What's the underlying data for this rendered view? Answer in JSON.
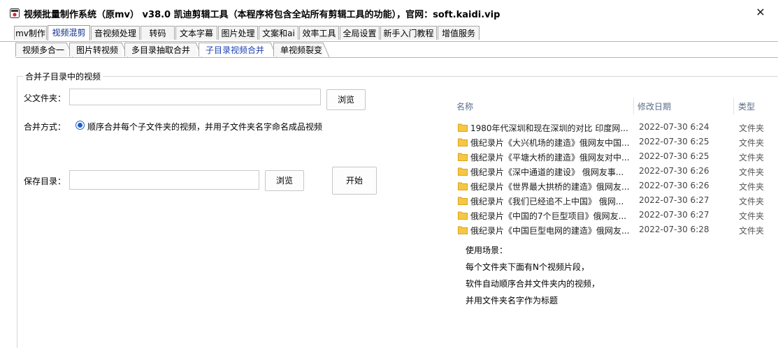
{
  "window": {
    "title": "视频批量制作系统（原mv） v38.0    凯迪剪辑工具（本程序将包含全站所有剪辑工具的功能），官网：soft.kaidi.vip",
    "close_glyph": "✕"
  },
  "main_tabs": [
    {
      "label": "mv制作"
    },
    {
      "label": "视频混剪",
      "active": true
    },
    {
      "label": "音视频处理"
    },
    {
      "label": "转码"
    },
    {
      "label": "文本字幕"
    },
    {
      "label": "图片处理"
    },
    {
      "label": "文案和ai"
    },
    {
      "label": "效率工具"
    },
    {
      "label": "全局设置"
    },
    {
      "label": "新手入门教程"
    },
    {
      "label": "增值服务"
    }
  ],
  "sub_tabs": [
    {
      "label": "视频多合一"
    },
    {
      "label": "图片转视频"
    },
    {
      "label": "多目录抽取合并"
    },
    {
      "label": "子目录视频合并",
      "active": true
    },
    {
      "label": "单视频裂变"
    }
  ],
  "group": {
    "title": "合并子目录中的视频",
    "parent_folder_label": "父文件夹：",
    "parent_folder_value": "",
    "browse_label": "浏览",
    "merge_mode_label": "合并方式：",
    "merge_mode_option": "顺序合并每个子文件夹的视频，并用子文件夹名字命名成品视频",
    "save_dir_label": "保存目录：",
    "save_dir_value": "",
    "browse2_label": "浏览",
    "start_label": "开始"
  },
  "file_list": {
    "columns": [
      "名称",
      "修改日期",
      "类型"
    ],
    "rows": [
      {
        "name": "1980年代深圳和现在深圳的对比 印度网...",
        "date": "2022-07-30 6:24",
        "type": "文件夹"
      },
      {
        "name": "俄纪录片《大兴机场的建造》俄网友中国...",
        "date": "2022-07-30 6:25",
        "type": "文件夹"
      },
      {
        "name": "俄纪录片《平塘大桥的建造》俄网友对中...",
        "date": "2022-07-30 6:25",
        "type": "文件夹"
      },
      {
        "name": "俄纪录片《深中通道的建设》 俄网友事...",
        "date": "2022-07-30 6:26",
        "type": "文件夹"
      },
      {
        "name": "俄纪录片《世界最大拱桥的建造》俄网友...",
        "date": "2022-07-30 6:26",
        "type": "文件夹"
      },
      {
        "name": "俄纪录片《我们已经追不上中国》 俄网...",
        "date": "2022-07-30 6:27",
        "type": "文件夹"
      },
      {
        "name": "俄纪录片《中国的7个巨型项目》俄网友...",
        "date": "2022-07-30 6:27",
        "type": "文件夹"
      },
      {
        "name": "俄纪录片《中国巨型电网的建造》俄网友...",
        "date": "2022-07-30 6:28",
        "type": "文件夹"
      }
    ]
  },
  "usage": [
    "使用场景：",
    "每个文件夹下面有N个视频片段，",
    "软件自动顺序合并文件夹内的视频，",
    "并用文件夹名字作为标题"
  ],
  "colors": {
    "folder": "#f5c744",
    "active_tab_text": "#0a2a8a",
    "radio": "#1e5fc8"
  }
}
